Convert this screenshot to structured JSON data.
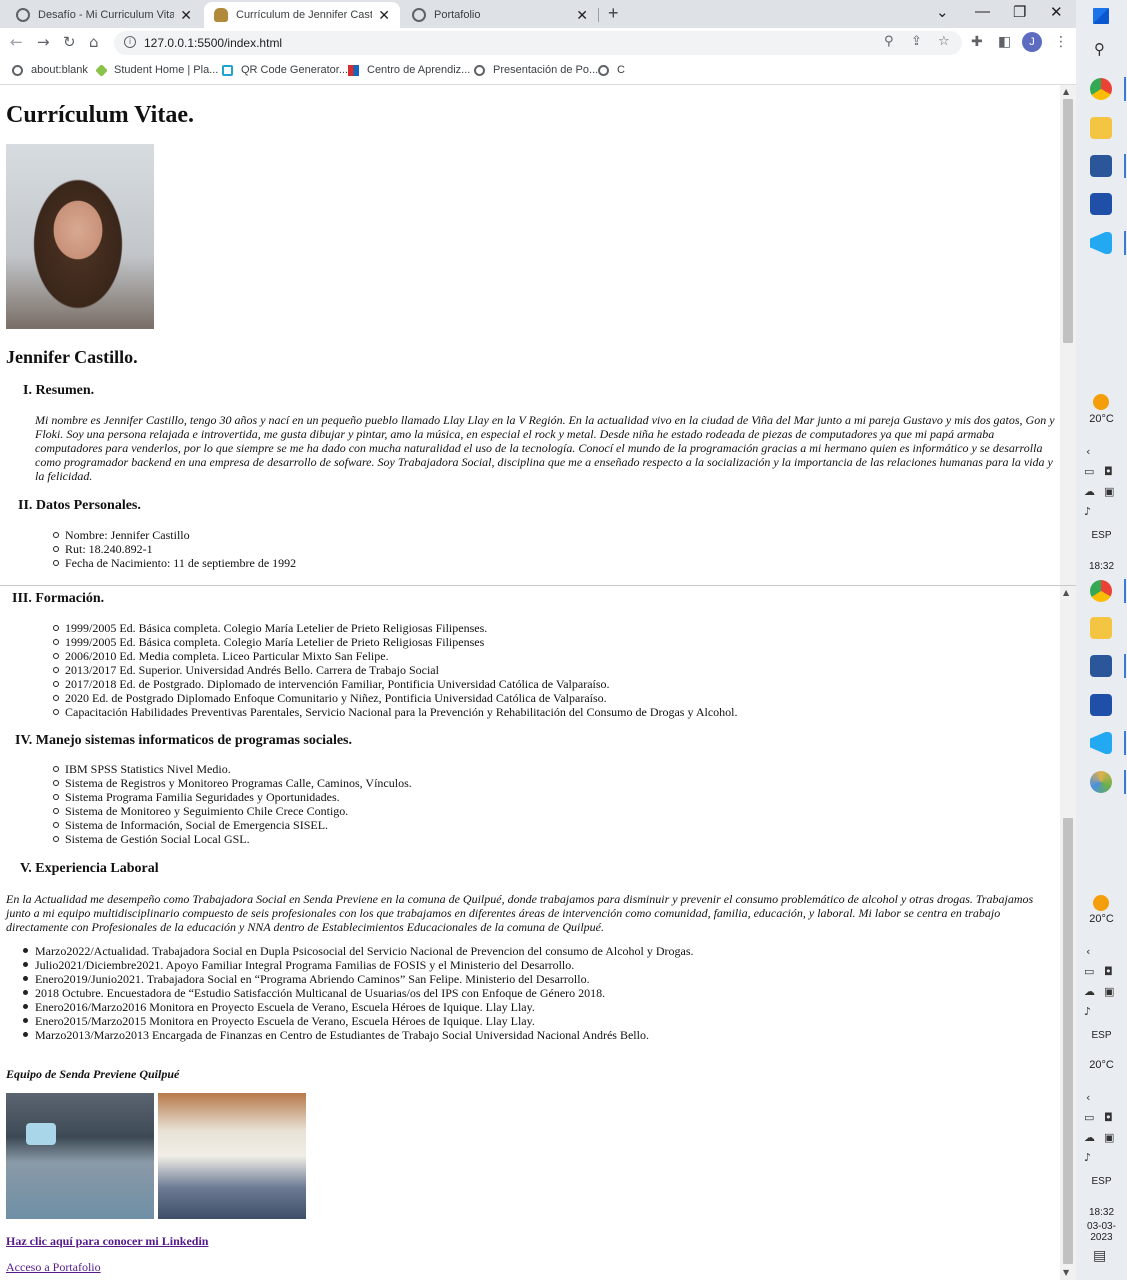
{
  "browser": {
    "tabs": [
      {
        "title": "Desafío - Mi Curriculum Vitae en"
      },
      {
        "title": "Currículum de Jennifer Castillo."
      },
      {
        "title": "Portafolio"
      }
    ],
    "url": "127.0.0.1:5500/index.html",
    "profile_initial": "J",
    "bookmarks": [
      "about:blank",
      "Student Home | Pla...",
      "QR Code Generator...",
      "Centro de Aprendiz...",
      "Presentación de Po...",
      "C"
    ]
  },
  "cv": {
    "title": "Currículum Vitae.",
    "name": "Jennifer Castillo.",
    "sections": {
      "resumen": {
        "heading": "I. Resumen.",
        "text": "Mi nombre es Jennifer Castillo, tengo 30 años y nací en un pequeño pueblo llamado Llay Llay en la V Región. En la actualidad vivo en la ciudad de Viña del Mar junto a mi pareja Gustavo y mis dos gatos, Gon y Floki. Soy una persona relajada e introvertida, me gusta dibujar y pintar, amo la música, en especial el rock y metal. Desde niña he estado rodeada de piezas de computadores ya que mi papá armaba computadores para venderlos, por lo que siempre se me ha dado con mucha naturalidad el uso de la tecnología. Conocí el mundo de la programación gracias a mi hermano quien es informático y se desarrolla como programador backend en una empresa de desarrollo de sofware. Soy Trabajadora Social, disciplina que me a enseñado respecto a la socialización y la importancia de las relaciones humanas para la vida y la felicidad."
      },
      "datos": {
        "heading": "II. Datos Personales.",
        "items": [
          "Nombre: Jennifer Castillo",
          "Rut: 18.240.892-1",
          "Fecha de Nacimiento: 11 de septiembre de 1992"
        ]
      },
      "formacion": {
        "heading": "III. Formación.",
        "items": [
          "1999/2005 Ed. Básica completa. Colegio María Letelier de Prieto Religiosas Filipenses.",
          "1999/2005 Ed. Básica completa. Colegio María Letelier de Prieto Religiosas Filipenses",
          "2006/2010 Ed. Media completa. Liceo Particular Mixto San Felipe.",
          "2013/2017 Ed. Superior. Universidad Andrés Bello. Carrera de Trabajo Social",
          "2017/2018 Ed. de Postgrado. Diplomado de intervención Familiar, Pontificia Universidad Católica de Valparaíso.",
          "2020 Ed. de Postgrado Diplomado Enfoque Comunitario y Niñez, Pontificia Universidad Católica de Valparaíso.",
          "Capacitación Habilidades Preventivas Parentales, Servicio Nacional para la Prevención y Rehabilitación del Consumo de Drogas y Alcohol."
        ]
      },
      "sistemas": {
        "heading": "IV. Manejo sistemas informaticos de programas sociales.",
        "items": [
          "IBM SPSS Statistics Nivel Medio.",
          "Sistema de Registros y Monitoreo Programas Calle, Caminos, Vínculos.",
          "Sistema Programa Familia Seguridades y Oportunidades.",
          "Sistema de Monitoreo y Seguimiento Chile Crece Contigo.",
          "Sistema de Información, Social de Emergencia SISEL.",
          "Sistema de Gestión Social Local GSL."
        ]
      },
      "experiencia": {
        "heading": "V. Experiencia Laboral",
        "text": "En la Actualidad me desempeño como Trabajadora Social en Senda Previene en la comuna de Quilpué, donde trabajamos para disminuir y prevenir el consumo problemático de alcohol y otras drogas. Trabajamos junto a mi equipo multidisciplinario compuesto de seis profesionales con los que trabajamos en diferentes áreas de intervención como comunidad, familia, educación, y laboral. Mi labor se centra en trabajo directamente con Profesionales de la educación y NNA dentro de Establecimientos Educacionales de la comuna de Quilpué.",
        "items": [
          "Marzo2022/Actualidad. Trabajadora Social en Dupla Psicosocial del Servicio Nacional de Prevencion del consumo de Alcohol y Drogas.",
          "Julio2021/Diciembre2021. Apoyo Familiar Integral Programa Familias de FOSIS y el Ministerio del Desarrollo.",
          "Enero2019/Junio2021. Trabajadora Social en “Programa Abriendo Caminos” San Felipe. Ministerio del Desarrollo.",
          "2018 Octubre. Encuestadora de “Estudio Satisfacción Multicanal de Usuarias/os del IPS con Enfoque de Género 2018.",
          "Enero2016/Marzo2016 Monitora en Proyecto Escuela de Verano, Escuela Héroes de Iquique. Llay Llay.",
          "Enero2015/Marzo2015 Monitora en Proyecto Escuela de Verano, Escuela Héroes de Iquique. Llay Llay.",
          "Marzo2013/Marzo2013 Encargada de Finanzas en Centro de Estudiantes de Trabajo Social Universidad Nacional Andrés Bello."
        ]
      }
    },
    "team_caption": "Equipo de Senda Previene Quilpué",
    "linkedin_link": "Haz clic aquí para conocer mi Linkedin",
    "portfolio_link": "Acceso a Portafolio"
  },
  "taskbar": {
    "temp": "20°C",
    "lang": "ESP",
    "time": "18:32",
    "date": "03-03-2023"
  }
}
